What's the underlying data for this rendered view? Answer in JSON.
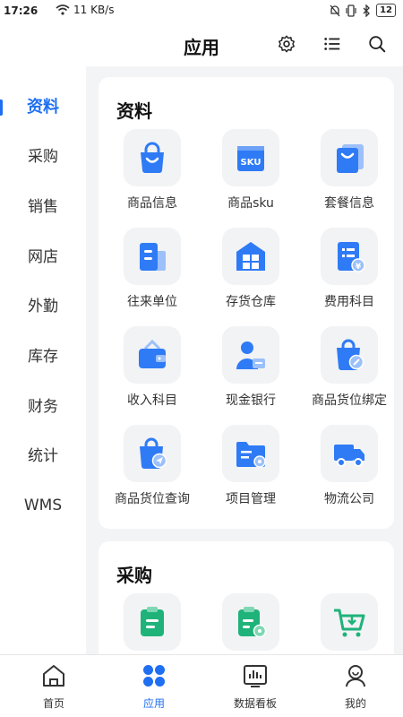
{
  "status_bar": {
    "time": "17:26",
    "net_speed": "11 KB/s",
    "battery": "12"
  },
  "header": {
    "title": "应用",
    "icons": [
      "gear-icon",
      "list-icon",
      "search-icon"
    ]
  },
  "sidebar": {
    "items": [
      {
        "label": "资料",
        "active": true
      },
      {
        "label": "采购",
        "active": false
      },
      {
        "label": "销售",
        "active": false
      },
      {
        "label": "网店",
        "active": false
      },
      {
        "label": "外勤",
        "active": false
      },
      {
        "label": "库存",
        "active": false
      },
      {
        "label": "财务",
        "active": false
      },
      {
        "label": "统计",
        "active": false
      },
      {
        "label": "WMS",
        "active": false
      }
    ]
  },
  "sections": [
    {
      "title": "资料",
      "items": [
        {
          "label": "商品信息",
          "icon": "shopping-bag-icon"
        },
        {
          "label": "商品sku",
          "icon": "sku-icon",
          "icon_text": "SKU"
        },
        {
          "label": "套餐信息",
          "icon": "stacked-bags-icon"
        },
        {
          "label": "往来单位",
          "icon": "building-icon"
        },
        {
          "label": "存货仓库",
          "icon": "warehouse-icon"
        },
        {
          "label": "费用科目",
          "icon": "expense-doc-icon"
        },
        {
          "label": "收入科目",
          "icon": "wallet-icon"
        },
        {
          "label": "现金银行",
          "icon": "bank-user-icon"
        },
        {
          "label": "商品货位绑定",
          "icon": "bag-link-icon"
        },
        {
          "label": "商品货位查询",
          "icon": "bag-send-icon"
        },
        {
          "label": "项目管理",
          "icon": "folder-gear-icon"
        },
        {
          "label": "物流公司",
          "icon": "truck-icon"
        }
      ]
    },
    {
      "title": "采购",
      "items": [
        {
          "label": "",
          "icon": "clipboard-icon"
        },
        {
          "label": "",
          "icon": "clipboard-gear-icon"
        },
        {
          "label": "",
          "icon": "cart-download-icon"
        }
      ]
    }
  ],
  "tabbar": {
    "items": [
      {
        "label": "首页",
        "icon": "home-icon",
        "active": false
      },
      {
        "label": "应用",
        "icon": "apps-icon",
        "active": true
      },
      {
        "label": "数据看板",
        "icon": "dashboard-icon",
        "active": false
      },
      {
        "label": "我的",
        "icon": "profile-icon",
        "active": false
      }
    ]
  },
  "colors": {
    "accent": "#1f6ff2",
    "icon_blue": "#2f7bf6",
    "icon_green": "#1fb37a"
  }
}
